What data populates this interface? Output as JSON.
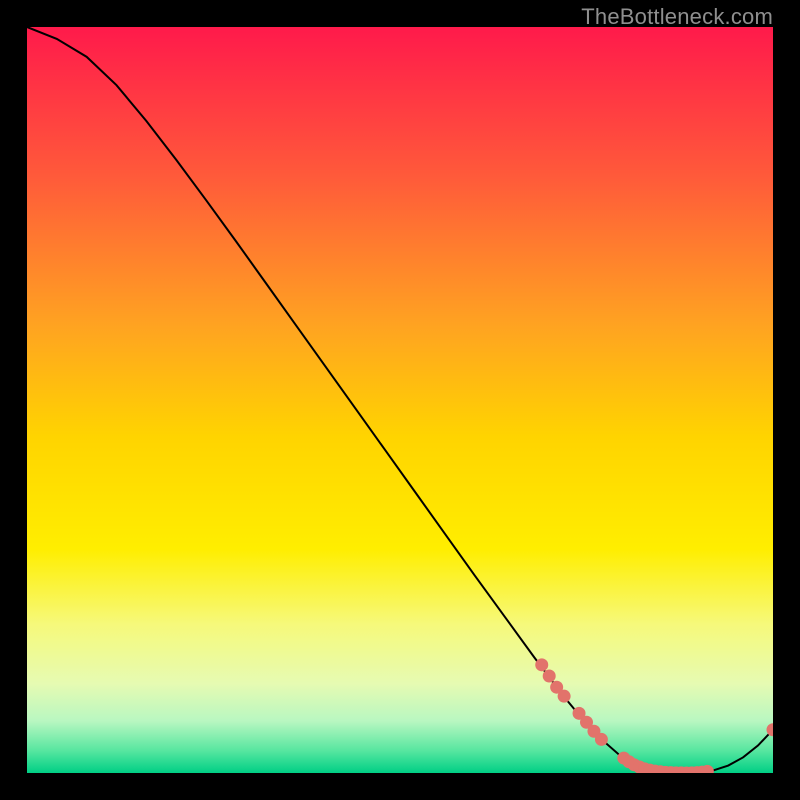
{
  "watermark": "TheBottleneck.com",
  "chart_data": {
    "type": "line",
    "title": "",
    "xlabel": "",
    "ylabel": "",
    "xlim": [
      0,
      100
    ],
    "ylim": [
      0,
      100
    ],
    "grid": false,
    "legend": false,
    "gradient_stops": [
      {
        "pos": 0.0,
        "color": "#ff1a4b"
      },
      {
        "pos": 0.2,
        "color": "#ff5a3a"
      },
      {
        "pos": 0.4,
        "color": "#ffa321"
      },
      {
        "pos": 0.55,
        "color": "#ffd400"
      },
      {
        "pos": 0.7,
        "color": "#ffee00"
      },
      {
        "pos": 0.8,
        "color": "#f6f97a"
      },
      {
        "pos": 0.88,
        "color": "#e6fbb2"
      },
      {
        "pos": 0.93,
        "color": "#b9f7c1"
      },
      {
        "pos": 0.97,
        "color": "#57e6a0"
      },
      {
        "pos": 1.0,
        "color": "#00cf85"
      }
    ],
    "series": [
      {
        "name": "bottleneck-curve",
        "color": "#000000",
        "x": [
          0,
          4,
          8,
          12,
          16,
          20,
          24,
          28,
          32,
          36,
          40,
          44,
          48,
          52,
          56,
          60,
          64,
          68,
          72,
          76,
          80,
          82,
          84,
          86,
          88,
          90,
          92,
          94,
          96,
          98,
          100
        ],
        "y": [
          100.0,
          98.4,
          96.0,
          92.2,
          87.4,
          82.2,
          76.8,
          71.3,
          65.7,
          60.1,
          54.5,
          48.9,
          43.3,
          37.7,
          32.1,
          26.5,
          21.0,
          15.5,
          10.2,
          5.4,
          1.9,
          0.9,
          0.3,
          0.05,
          0.0,
          0.05,
          0.35,
          1.0,
          2.1,
          3.7,
          5.8
        ]
      }
    ],
    "markers": {
      "name": "data-points",
      "color": "#e2736b",
      "radius": 6.5,
      "points": [
        {
          "x": 69.0,
          "y": 14.5
        },
        {
          "x": 70.0,
          "y": 13.0
        },
        {
          "x": 71.0,
          "y": 11.5
        },
        {
          "x": 72.0,
          "y": 10.3
        },
        {
          "x": 74.0,
          "y": 8.0
        },
        {
          "x": 75.0,
          "y": 6.8
        },
        {
          "x": 76.0,
          "y": 5.6
        },
        {
          "x": 77.0,
          "y": 4.5
        },
        {
          "x": 80.0,
          "y": 2.0
        },
        {
          "x": 80.7,
          "y": 1.5
        },
        {
          "x": 81.4,
          "y": 1.1
        },
        {
          "x": 82.1,
          "y": 0.8
        },
        {
          "x": 82.8,
          "y": 0.55
        },
        {
          "x": 83.5,
          "y": 0.38
        },
        {
          "x": 84.2,
          "y": 0.25
        },
        {
          "x": 84.9,
          "y": 0.16
        },
        {
          "x": 85.6,
          "y": 0.09
        },
        {
          "x": 86.3,
          "y": 0.05
        },
        {
          "x": 87.0,
          "y": 0.02
        },
        {
          "x": 87.7,
          "y": 0.01
        },
        {
          "x": 88.4,
          "y": 0.0
        },
        {
          "x": 89.1,
          "y": 0.02
        },
        {
          "x": 89.8,
          "y": 0.05
        },
        {
          "x": 90.5,
          "y": 0.11
        },
        {
          "x": 91.2,
          "y": 0.22
        },
        {
          "x": 100.0,
          "y": 5.8
        }
      ]
    }
  }
}
